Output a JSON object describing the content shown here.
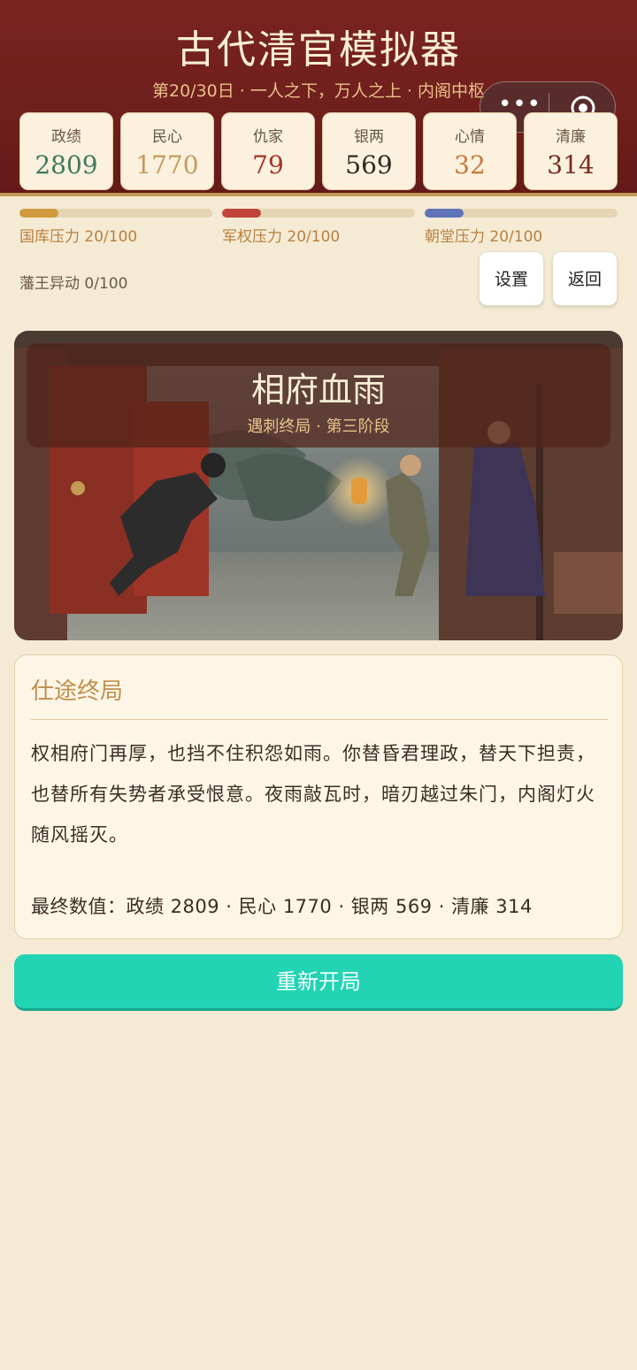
{
  "header": {
    "title": "古代清官模拟器",
    "subtitle": "第20/30日 · 一人之下，万人之上 · 内阁中枢"
  },
  "capsule": {
    "more_icon": "more-dots-icon",
    "close_icon": "target-circle-icon"
  },
  "stats": [
    {
      "label": "政绩",
      "value": "2809",
      "color": "#3f7a5e"
    },
    {
      "label": "民心",
      "value": "1770",
      "color": "#c49a5c"
    },
    {
      "label": "仇家",
      "value": "79",
      "color": "#a5332b"
    },
    {
      "label": "银两",
      "value": "569",
      "color": "#2e2a25"
    },
    {
      "label": "心情",
      "value": "32",
      "color": "#c8783a"
    },
    {
      "label": "清廉",
      "value": "314",
      "color": "#7a2a20"
    }
  ],
  "pressures": [
    {
      "label": "国库压力 20/100",
      "level": 0.2,
      "color": "#d19a3e"
    },
    {
      "label": "军权压力 20/100",
      "level": 0.2,
      "color": "#c0443a"
    },
    {
      "label": "朝堂压力 20/100",
      "level": 0.2,
      "color": "#5f74b8"
    }
  ],
  "fan_label": "藩王异动 0/100",
  "buttons": {
    "settings": "设置",
    "back": "返回",
    "restart": "重新开局"
  },
  "scene": {
    "title": "相府血雨",
    "subtitle": "遇刺终局 · 第三阶段"
  },
  "ending": {
    "heading": "仕途终局",
    "body": "权相府门再厚，也挡不住积怨如雨。你替昏君理政，替天下担责，也替所有失势者承受恨意。夜雨敲瓦时，暗刃越过朱门，内阁灯火随风摇灭。",
    "final": "最终数值：政绩 2809 · 民心 1770 · 银两 569 · 清廉 314"
  }
}
